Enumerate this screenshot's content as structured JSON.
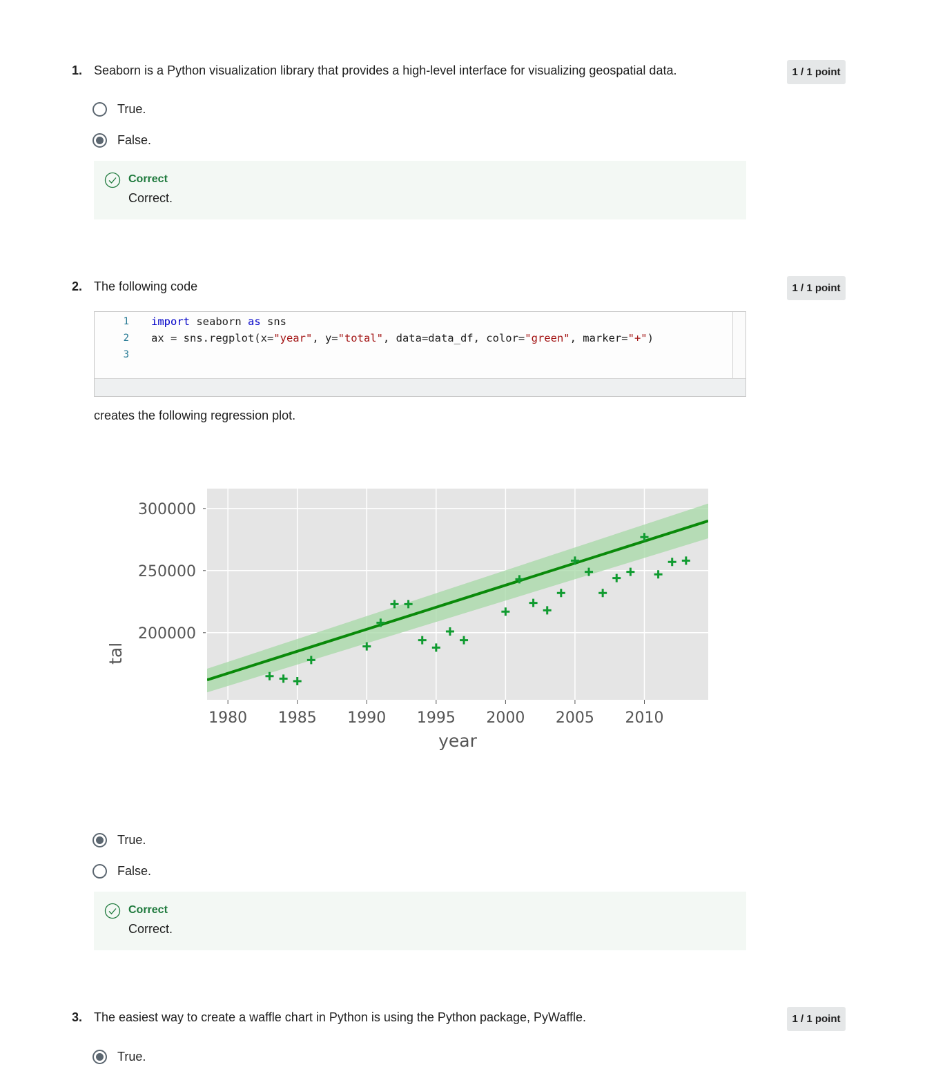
{
  "questions": [
    {
      "number": "1.",
      "text": "Seaborn is a Python visualization library that provides a high-level interface for visualizing geospatial data.",
      "points": "1 / 1 point",
      "options": [
        {
          "label": "True.",
          "selected": false
        },
        {
          "label": "False.",
          "selected": true
        }
      ],
      "feedback": {
        "title": "Correct",
        "text": "Correct."
      }
    },
    {
      "number": "2.",
      "text": "The following code",
      "points": "1 / 1 point",
      "code": {
        "line_numbers": [
          "1",
          "2",
          "3"
        ],
        "lines": [
          [
            {
              "t": "import",
              "k": "kw"
            },
            {
              "t": " seaborn ",
              "k": "plain"
            },
            {
              "t": "as",
              "k": "kw"
            },
            {
              "t": " sns",
              "k": "plain"
            }
          ],
          [
            {
              "t": "ax = sns.regplot(x=",
              "k": "plain"
            },
            {
              "t": "\"year\"",
              "k": "str"
            },
            {
              "t": ", y=",
              "k": "plain"
            },
            {
              "t": "\"total\"",
              "k": "str"
            },
            {
              "t": ", data=data_df, color=",
              "k": "plain"
            },
            {
              "t": "\"green\"",
              "k": "str"
            },
            {
              "t": ", marker=",
              "k": "plain"
            },
            {
              "t": "\"+\"",
              "k": "str"
            },
            {
              "t": ")",
              "k": "plain"
            }
          ],
          []
        ]
      },
      "after_code_text": "creates the following regression plot.",
      "options": [
        {
          "label": "True.",
          "selected": true
        },
        {
          "label": "False.",
          "selected": false
        }
      ],
      "feedback": {
        "title": "Correct",
        "text": "Correct."
      }
    },
    {
      "number": "3.",
      "text": "The easiest way to create a waffle chart in Python is using the Python package, PyWaffle.",
      "points": "1 / 1 point",
      "options": [
        {
          "label": "True.",
          "selected": true
        }
      ]
    }
  ],
  "chart_data": {
    "type": "scatter",
    "xlabel": "year",
    "ylabel": "tal",
    "xticks": [
      "1980",
      "1985",
      "1990",
      "1995",
      "2000",
      "2005",
      "2010"
    ],
    "yticks": [
      "300000",
      "250000",
      "200000"
    ],
    "xlim": [
      1978.5,
      2014.6
    ],
    "ylim": [
      146000,
      316000
    ],
    "colors": {
      "points": "#109b30",
      "line": "#0a8a0a",
      "band": "#a6d8a6",
      "background": "#e5e5e5",
      "grid": "#ffffff"
    },
    "grid": true,
    "points": [
      {
        "x": 1983,
        "y": 165000
      },
      {
        "x": 1984,
        "y": 163000
      },
      {
        "x": 1985,
        "y": 161000
      },
      {
        "x": 1986,
        "y": 178000
      },
      {
        "x": 1990,
        "y": 189000
      },
      {
        "x": 1991,
        "y": 208000
      },
      {
        "x": 1992,
        "y": 223000
      },
      {
        "x": 1993,
        "y": 223000
      },
      {
        "x": 1994,
        "y": 194000
      },
      {
        "x": 1995,
        "y": 188000
      },
      {
        "x": 1996,
        "y": 201000
      },
      {
        "x": 1997,
        "y": 194000
      },
      {
        "x": 2000,
        "y": 217000
      },
      {
        "x": 2001,
        "y": 243000
      },
      {
        "x": 2002,
        "y": 224000
      },
      {
        "x": 2003,
        "y": 218000
      },
      {
        "x": 2004,
        "y": 232000
      },
      {
        "x": 2005,
        "y": 258000
      },
      {
        "x": 2006,
        "y": 249000
      },
      {
        "x": 2007,
        "y": 232000
      },
      {
        "x": 2008,
        "y": 244000
      },
      {
        "x": 2009,
        "y": 249000
      },
      {
        "x": 2010,
        "y": 277000
      },
      {
        "x": 2011,
        "y": 247000
      },
      {
        "x": 2012,
        "y": 257000
      },
      {
        "x": 2013,
        "y": 258000
      }
    ],
    "regression": {
      "x": [
        1978.5,
        2014.6
      ],
      "y": [
        162000,
        290000
      ]
    },
    "confidence_band": {
      "x": [
        1978.5,
        2014.6
      ],
      "upper": [
        171000,
        304000
      ],
      "lower": [
        152000,
        276000
      ]
    }
  }
}
